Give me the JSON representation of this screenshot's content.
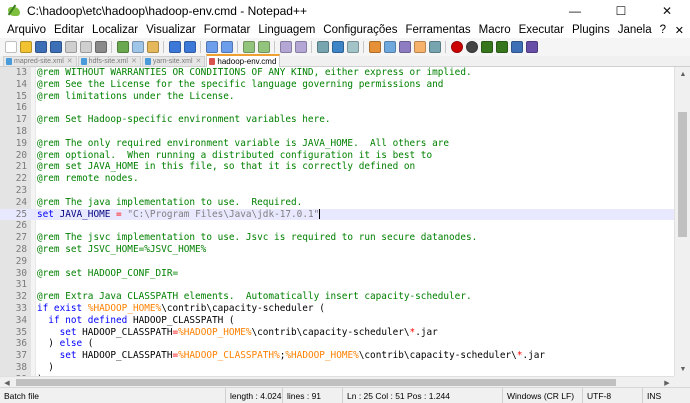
{
  "window": {
    "title": "C:\\hadoop\\etc\\hadoop\\hadoop-env.cmd - Notepad++",
    "controls": [
      "—",
      "☐",
      "✕"
    ]
  },
  "menu": [
    "Arquivo",
    "Editar",
    "Localizar",
    "Visualizar",
    "Formatar",
    "Linguagem",
    "Configurações",
    "Ferramentas",
    "Macro",
    "Executar",
    "Plugins",
    "Janela",
    "?"
  ],
  "menu_close": "✕",
  "toolbar_icons": [
    "new-file-icon",
    "open-file-icon",
    "save-icon",
    "save-all-icon",
    "close-icon",
    "close-all-icon",
    "print-icon",
    "cut-icon",
    "copy-icon",
    "paste-icon",
    "undo-icon",
    "redo-icon",
    "find-icon",
    "replace-icon",
    "zoom-in-icon",
    "zoom-out-icon",
    "sync-vertical-icon",
    "sync-horizontal-icon",
    "word-wrap-icon",
    "show-all-chars-icon",
    "indent-guide-icon",
    "language-icon",
    "document-map-icon",
    "function-list-icon",
    "folder-workspace-icon",
    "monitoring-icon",
    "record-macro-icon",
    "stop-macro-icon",
    "play-macro-icon",
    "run-macro-multiple-icon",
    "save-macro-icon",
    "spellcheck-icon"
  ],
  "tabs": [
    {
      "label": "mapred-site.xml",
      "close": "✕",
      "active": false
    },
    {
      "label": "hdfs-site.xml",
      "close": "✕",
      "active": false
    },
    {
      "label": "yarn-site.xml",
      "close": "✕",
      "active": false
    },
    {
      "label": "hadoop-env.cmd",
      "close": "✕",
      "active": true
    }
  ],
  "lines": [
    {
      "n": "13",
      "t": [
        [
          "cmt",
          "@rem WITHOUT WARRANTIES OR CONDITIONS OF ANY KIND, either express or implied."
        ]
      ]
    },
    {
      "n": "14",
      "t": [
        [
          "cmt",
          "@rem See the License for the specific language governing permissions and"
        ]
      ]
    },
    {
      "n": "15",
      "t": [
        [
          "cmt",
          "@rem limitations under the License."
        ]
      ]
    },
    {
      "n": "16",
      "t": []
    },
    {
      "n": "17",
      "t": [
        [
          "cmt",
          "@rem Set Hadoop-specific environment variables here."
        ]
      ]
    },
    {
      "n": "18",
      "t": []
    },
    {
      "n": "19",
      "t": [
        [
          "cmt",
          "@rem The only required environment variable is JAVA_HOME.  All others are"
        ]
      ]
    },
    {
      "n": "20",
      "t": [
        [
          "cmt",
          "@rem optional.  When running a distributed configuration it is best to"
        ]
      ]
    },
    {
      "n": "21",
      "t": [
        [
          "cmt",
          "@rem set JAVA_HOME in this file, so that it is correctly defined on"
        ]
      ]
    },
    {
      "n": "22",
      "t": [
        [
          "cmt",
          "@rem remote nodes."
        ]
      ]
    },
    {
      "n": "23",
      "t": []
    },
    {
      "n": "24",
      "t": [
        [
          "cmt",
          "@rem The java implementation to use.  Required."
        ]
      ]
    },
    {
      "n": "25",
      "t": [
        [
          "kw",
          "set"
        ],
        [
          "plain",
          " JAVA_HOME "
        ],
        [
          "op",
          "="
        ],
        [
          "plain",
          " "
        ],
        [
          "str",
          "\"C:\\Program Files\\Java\\jdk-17.0.1\""
        ]
      ],
      "current": true
    },
    {
      "n": "26",
      "t": []
    },
    {
      "n": "27",
      "t": [
        [
          "cmt",
          "@rem The jsvc implementation to use. Jsvc is required to run secure datanodes."
        ]
      ]
    },
    {
      "n": "28",
      "t": [
        [
          "cmt",
          "@rem set JSVC_HOME=%JSVC_HOME%"
        ]
      ]
    },
    {
      "n": "29",
      "t": []
    },
    {
      "n": "30",
      "t": [
        [
          "cmt",
          "@rem set HADOOP_CONF_DIR="
        ]
      ]
    },
    {
      "n": "31",
      "t": []
    },
    {
      "n": "32",
      "t": [
        [
          "cmt",
          "@rem Extra Java CLASSPATH elements.  Automatically insert capacity-scheduler."
        ]
      ]
    },
    {
      "n": "33",
      "t": [
        [
          "kw",
          "if exist"
        ],
        [
          "txt",
          " "
        ],
        [
          "var",
          "%HADOOP_HOME%"
        ],
        [
          "txt",
          "\\contrib\\capacity-scheduler ("
        ]
      ]
    },
    {
      "n": "34",
      "t": [
        [
          "txt",
          "  "
        ],
        [
          "kw",
          "if not defined"
        ],
        [
          "txt",
          " HADOOP_CLASSPATH ("
        ]
      ]
    },
    {
      "n": "35",
      "t": [
        [
          "txt",
          "    "
        ],
        [
          "kw",
          "set"
        ],
        [
          "txt",
          " HADOOP_CLASSPATH"
        ],
        [
          "op",
          "="
        ],
        [
          "var",
          "%HADOOP_HOME%"
        ],
        [
          "txt",
          "\\contrib\\capacity-scheduler\\"
        ],
        [
          "op",
          "*"
        ],
        [
          "txt",
          ".jar"
        ]
      ]
    },
    {
      "n": "36",
      "t": [
        [
          "txt",
          "  ) "
        ],
        [
          "kw",
          "else"
        ],
        [
          "txt",
          " ("
        ]
      ]
    },
    {
      "n": "37",
      "t": [
        [
          "txt",
          "    "
        ],
        [
          "kw",
          "set"
        ],
        [
          "txt",
          " HADOOP_CLASSPATH"
        ],
        [
          "op",
          "="
        ],
        [
          "var",
          "%HADOOP_CLASSPATH%"
        ],
        [
          "txt",
          ";"
        ],
        [
          "var",
          "%HADOOP_HOME%"
        ],
        [
          "txt",
          "\\contrib\\capacity-scheduler\\"
        ],
        [
          "op",
          "*"
        ],
        [
          "txt",
          ".jar"
        ]
      ]
    },
    {
      "n": "38",
      "t": [
        [
          "txt",
          "  )"
        ]
      ]
    },
    {
      "n": "39",
      "t": [
        [
          "txt",
          ")"
        ]
      ]
    }
  ],
  "status": {
    "type": "Batch file",
    "length": "length : 4.024",
    "lines": "lines : 91",
    "position": "Ln : 25    Col : 51    Pos : 1.244",
    "eol": "Windows (CR LF)",
    "encoding": "UTF-8",
    "mode": "INS"
  }
}
